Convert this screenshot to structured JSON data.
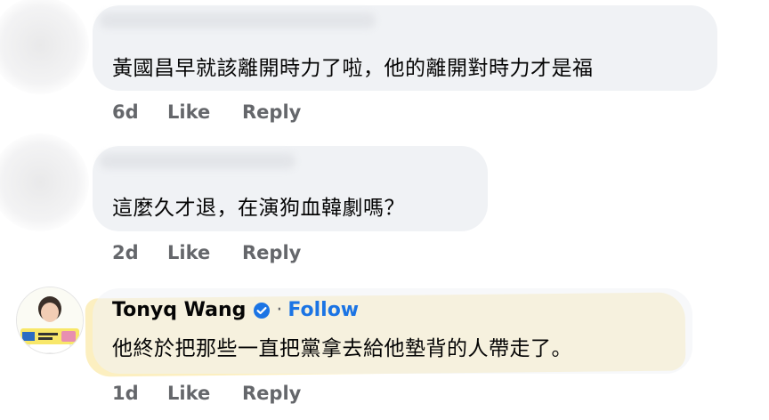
{
  "comments": [
    {
      "text": "黃國昌早就該離開時力了啦，他的離開對時力才是福",
      "time": "6d",
      "like_label": "Like",
      "reply_label": "Reply"
    },
    {
      "text": "這麼久才退，在演狗血韓劇嗎？",
      "time": "2d",
      "like_label": "Like",
      "reply_label": "Reply"
    },
    {
      "author": "Tonyq Wang",
      "separator": "·",
      "follow_label": "Follow",
      "text": "他終於把那些一直把黨拿去給他墊背的人帶走了。",
      "time": "1d",
      "like_label": "Like",
      "reply_label": "Reply"
    }
  ],
  "colors": {
    "bubble": "#f0f2f5",
    "meta_text": "#65676b",
    "follow": "#1b74e4",
    "verified_badge": "#1b74e4",
    "highlight": "#fae18c"
  },
  "icons": {
    "verified": "verified-check-icon"
  }
}
